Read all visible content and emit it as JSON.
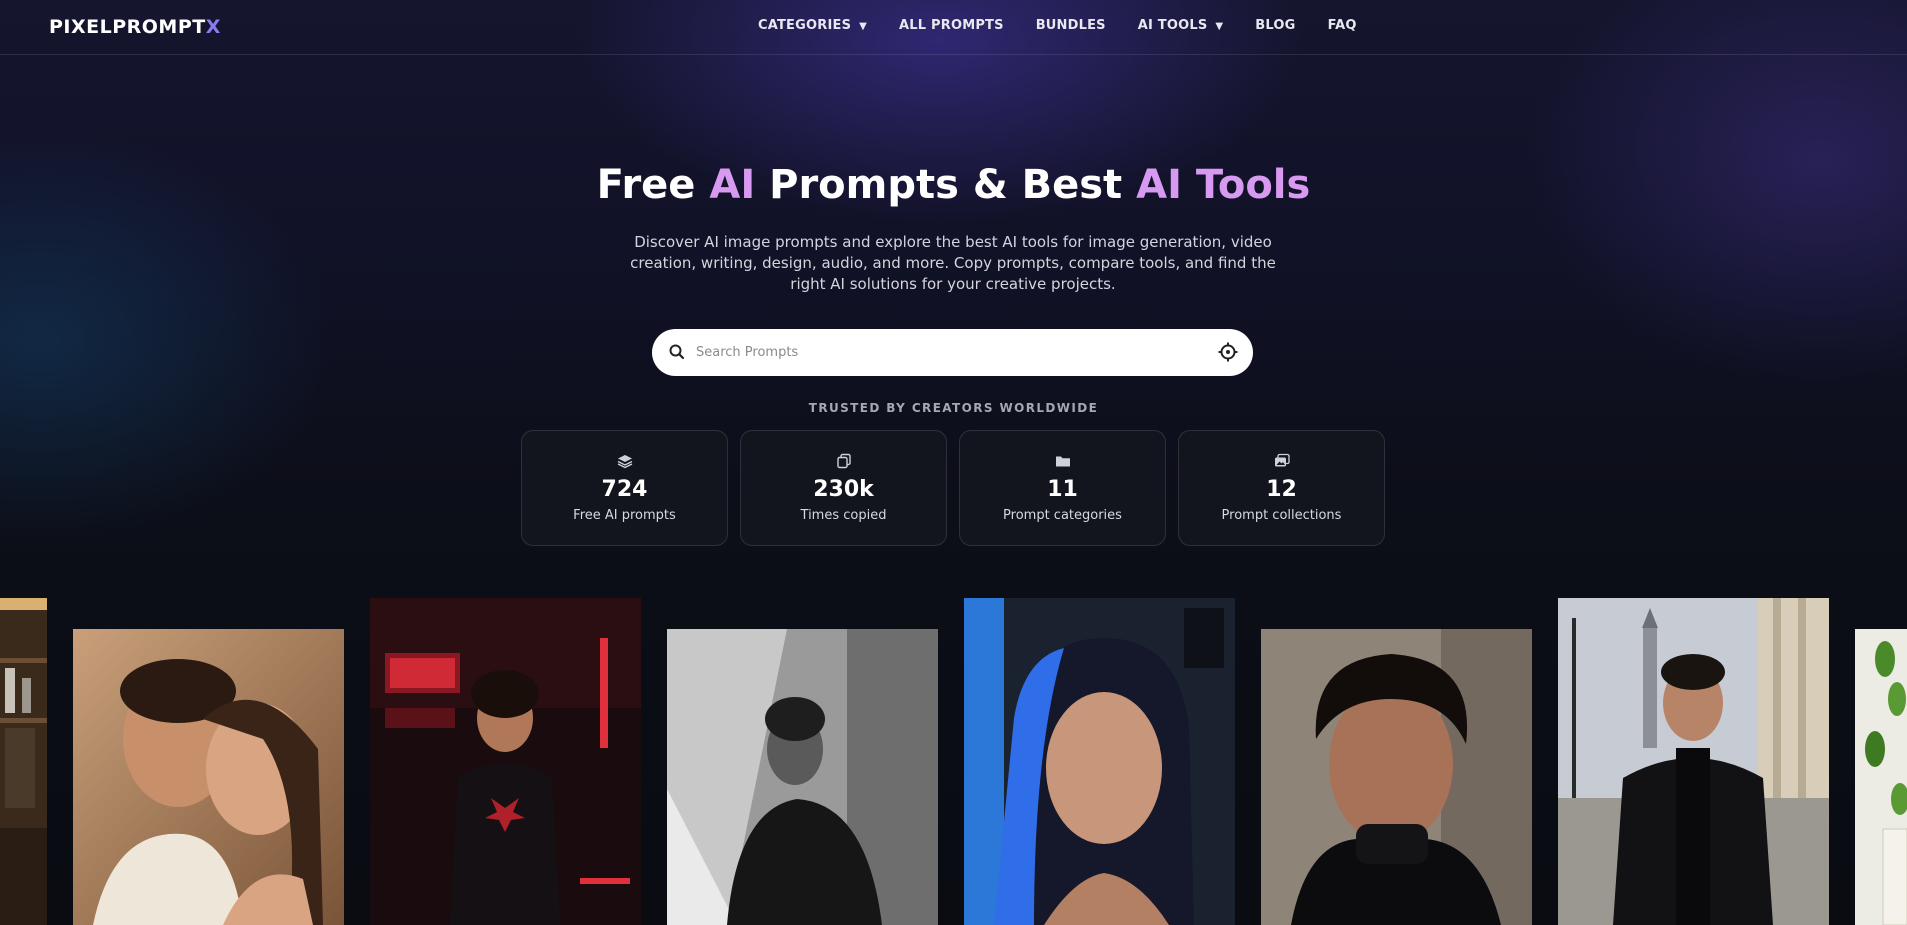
{
  "brand": {
    "name": "PIXELPROMPT",
    "suffix": "X"
  },
  "nav": {
    "items": [
      {
        "label": "CATEGORIES",
        "dropdown": true
      },
      {
        "label": "ALL PROMPTS",
        "dropdown": false
      },
      {
        "label": "BUNDLES",
        "dropdown": false
      },
      {
        "label": "AI TOOLS",
        "dropdown": true
      },
      {
        "label": "BLOG",
        "dropdown": false
      },
      {
        "label": "FAQ",
        "dropdown": false
      }
    ]
  },
  "hero": {
    "title_part1": "Free ",
    "title_accent1": "AI",
    "title_part2": " Prompts & Best ",
    "title_accent2": "AI Tools",
    "description": "Discover AI image prompts and explore the best AI tools for image generation, video creation, writing, design, audio, and more. Copy prompts, compare tools, and find the right AI solutions for your creative projects."
  },
  "search": {
    "placeholder": "Search Prompts",
    "value": ""
  },
  "trusted_label": "TRUSTED BY CREATORS WORLDWIDE",
  "stats": [
    {
      "icon": "layers-icon",
      "value": "724",
      "label": "Free AI prompts"
    },
    {
      "icon": "copy-icon",
      "value": "230k",
      "label": "Times copied"
    },
    {
      "icon": "folder-icon",
      "value": "11",
      "label": "Prompt categories"
    },
    {
      "icon": "images-icon",
      "value": "12",
      "label": "Prompt collections"
    }
  ],
  "gallery": {
    "items": [
      {
        "subject": "shelf-photo"
      },
      {
        "subject": "couple-portrait"
      },
      {
        "subject": "spider-hoodie-portrait"
      },
      {
        "subject": "monochrome-portrait"
      },
      {
        "subject": "blue-lit-woman-portrait"
      },
      {
        "subject": "turtleneck-man-portrait"
      },
      {
        "subject": "coat-man-street-portrait"
      },
      {
        "subject": "leaves-photo"
      }
    ]
  },
  "colors": {
    "accent": "#d79af0",
    "brand_x": "#8a7cf0",
    "background": "#0a0c12"
  }
}
